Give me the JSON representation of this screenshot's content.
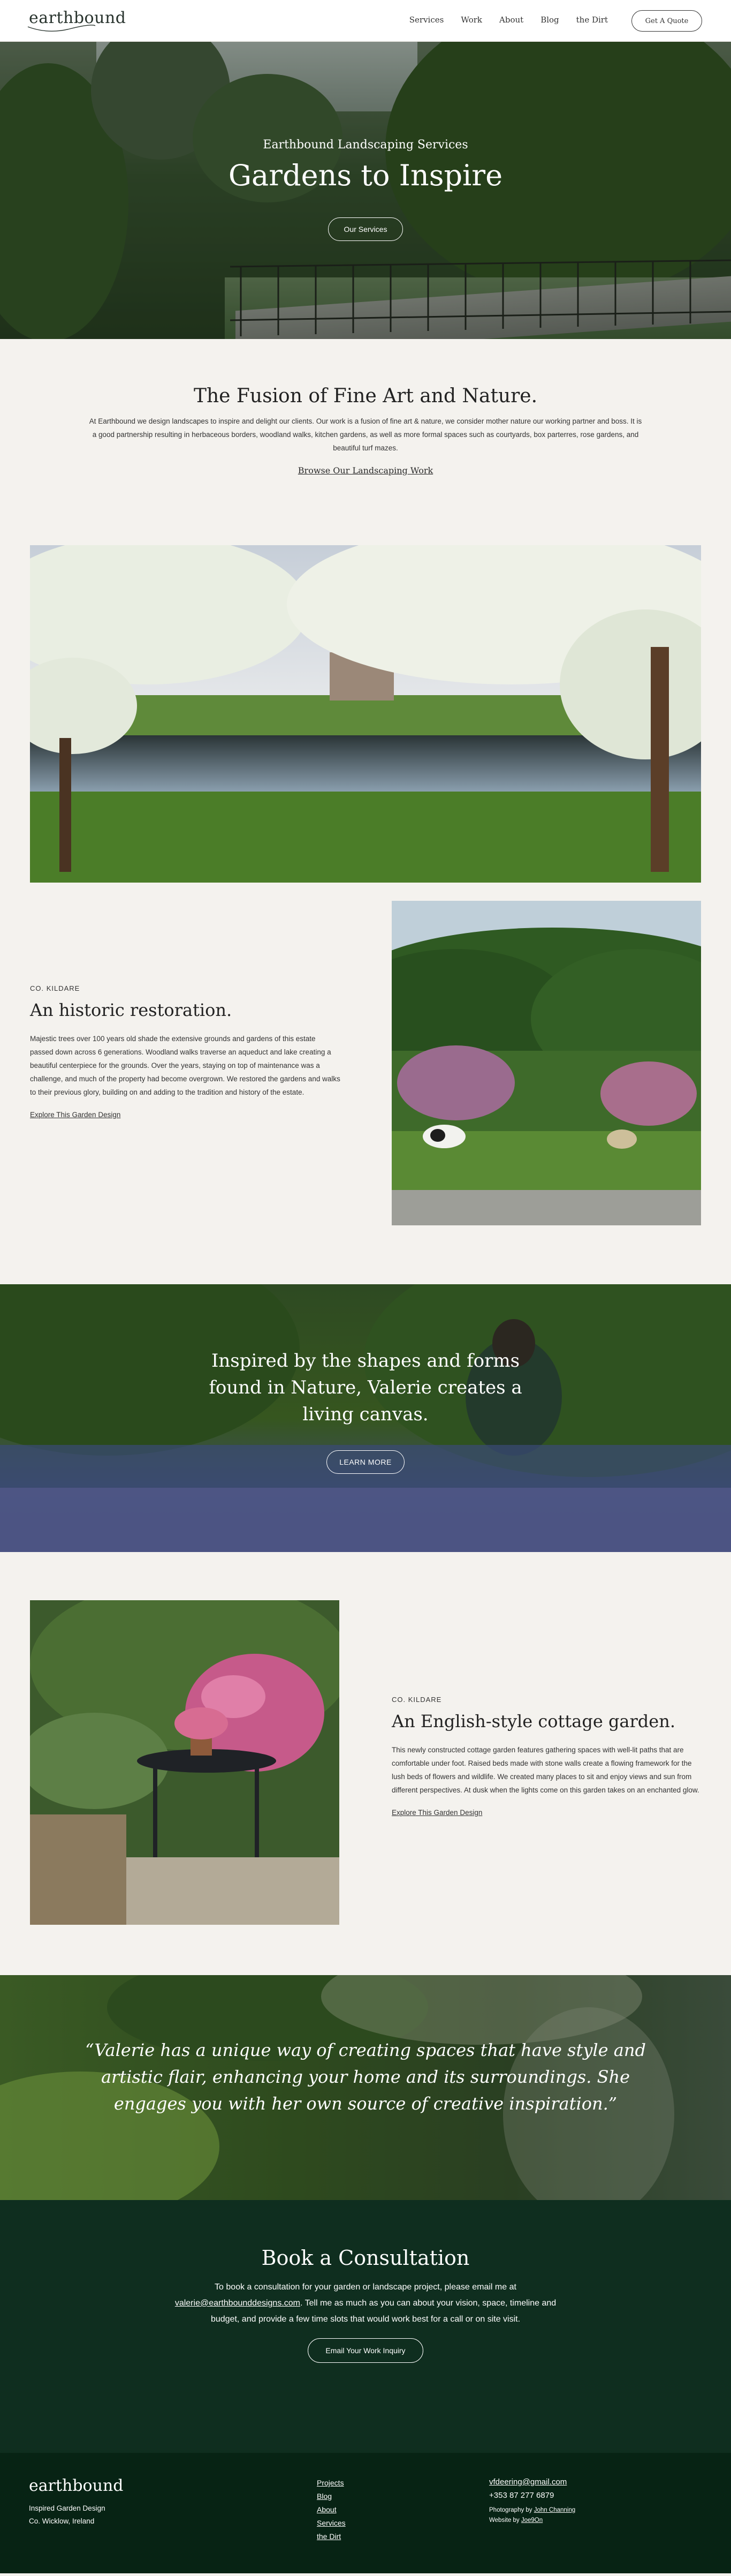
{
  "header": {
    "logo": "earthbound",
    "nav": [
      "Services",
      "Work",
      "About",
      "Blog",
      "the Dirt"
    ],
    "cta": "Get A Quote"
  },
  "hero": {
    "subtitle": "Earthbound Landscaping Services",
    "title": "Gardens to Inspire",
    "button": "Our Services"
  },
  "fusion": {
    "title": "The Fusion of Fine Art and Nature.",
    "body": "At Earthbound we design landscapes to inspire and delight our clients. Our work is a fusion of fine art & nature, we consider mother nature our working partner and boss. It is a good partnership resulting in herbaceous borders, woodland walks, kitchen gardens, as well as more formal spaces such as courtyards, box parterres, rose gardens, and beautiful turf mazes.",
    "link": "Browse Our Landscaping Work"
  },
  "restoration": {
    "eyebrow": "CO. KILDARE",
    "title": "An historic restoration.",
    "body": "Majestic trees over 100 years old shade the extensive grounds and gardens of this estate passed down across 6 generations. Woodland walks traverse an aqueduct and lake creating a beautiful centerpiece for the grounds. Over the years, staying on top of maintenance was a challenge, and much of the property had become overgrown. We restored the gardens and walks to their previous glory, building on and adding to the tradition and history of the estate.",
    "link": "Explore This Garden Design"
  },
  "bluebell": {
    "line1": "Inspired by the shapes and forms",
    "line2": "found in Nature, Valerie creates a",
    "line3": "living canvas.",
    "button": "LEARN MORE"
  },
  "cottage": {
    "eyebrow": "CO. KILDARE",
    "title": "An English-style cottage garden.",
    "body": "This newly constructed cottage garden features gathering spaces with well-lit paths that are comfortable under foot. Raised beds made with stone walls create a flowing framework for the lush beds of flowers and wildlife. We created many places to sit and enjoy views and sun from different perspectives. At dusk when the lights come on this garden takes on an enchanted glow.",
    "link": "Explore This Garden Design"
  },
  "testimonial": {
    "quote": "“Valerie has a unique way of creating spaces that have style and artistic flair, enhancing your home and its surroundings. She engages you with her own source of creative inspiration.”"
  },
  "consult": {
    "title": "Book a Consultation",
    "text_before": "To book a consultation for your garden or landscape project, please email me at",
    "email": "valerie@earthbounddesigns.com",
    "text_after": ". Tell me as much as you can about your vision, space, timeline and budget, and provide a few time slots that would work best for a call or on site visit.",
    "button": "Email Your Work Inquiry"
  },
  "footer": {
    "logo": "earthbound",
    "tagline": "Inspired Garden Design",
    "location": "Co. Wicklow, Ireland",
    "links": [
      "Projects",
      "Blog",
      "About",
      "Services",
      "the Dirt"
    ],
    "email": "vfdeering@gmail.com",
    "phone": "+353 87 277 6879",
    "photo_label": "Photography by ",
    "photographer": "John Channing",
    "website_label": "Website by ",
    "website_by": "Joe9On"
  }
}
